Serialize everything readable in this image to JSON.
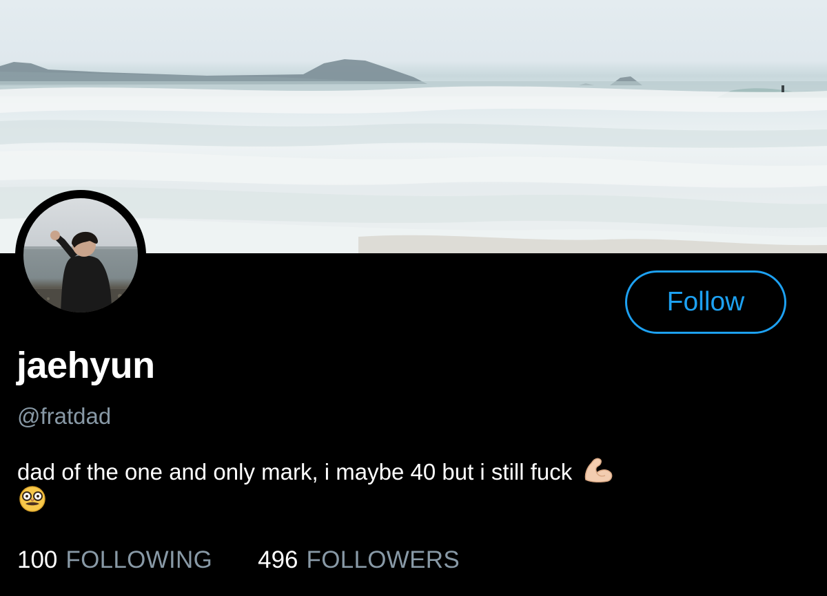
{
  "profile": {
    "display_name": "jaehyun",
    "handle": "@fratdad",
    "bio_line1": "dad of the one and only mark, i maybe 40 but i still fuck",
    "bio_line1_emoji": "flexed-biceps-icon",
    "bio_line2_emoji": "disguised-face-icon"
  },
  "actions": {
    "follow_label": "Follow"
  },
  "stats": {
    "following_count": "100",
    "following_label": "FOLLOWING",
    "followers_count": "496",
    "followers_label": "FOLLOWERS"
  },
  "colors": {
    "background": "#000000",
    "accent": "#1da1f2",
    "secondary_text": "#8899a6",
    "primary_text": "#ffffff"
  }
}
